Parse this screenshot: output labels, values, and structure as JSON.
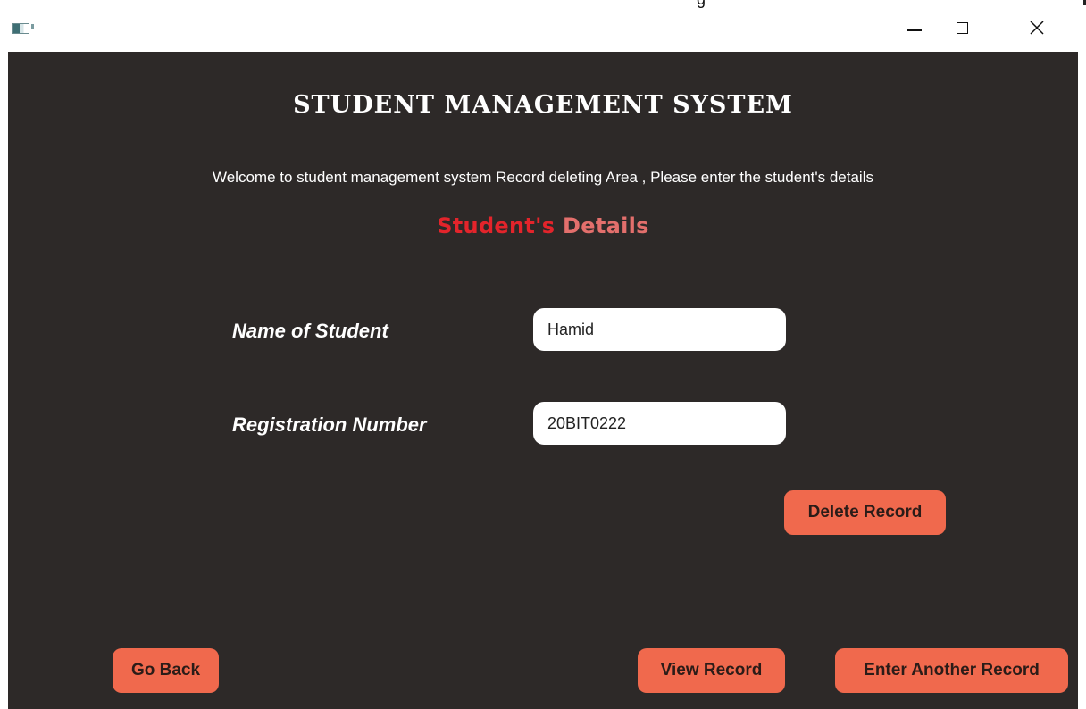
{
  "window": {
    "title_fragment": "g",
    "icon": "app-window-icon",
    "controls": {
      "minimize": "minimize-icon",
      "maximize": "maximize-icon",
      "close": "close-icon"
    }
  },
  "header": {
    "title": "STUDENT MANAGEMENT SYSTEM",
    "welcome": "Welcome to student management system Record deleting Area , Please enter the student's details"
  },
  "section": {
    "heading_part1": "Student's",
    "heading_part2": " Details"
  },
  "form": {
    "name_label": "Name of Student",
    "name_value": "Hamid",
    "reg_label": "Registration Number",
    "reg_value": "20BIT0222"
  },
  "buttons": {
    "delete": "Delete Record",
    "go_back": "Go Back",
    "view": "View Record",
    "another": "Enter Another Record"
  },
  "colors": {
    "background": "#2d2928",
    "button": "#f0694d",
    "heading_red": "#e3242b",
    "heading_pink": "#e36f6c"
  }
}
